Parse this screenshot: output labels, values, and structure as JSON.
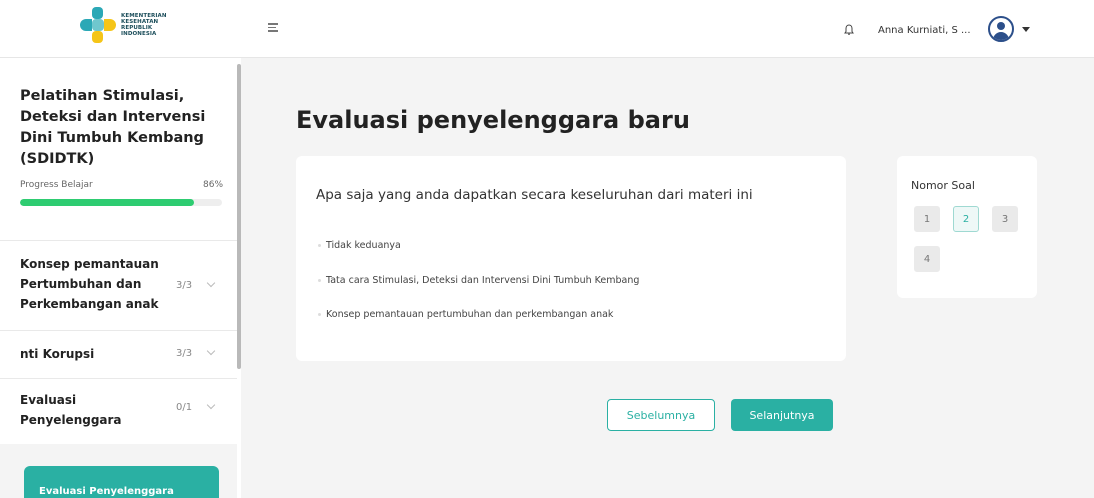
{
  "header": {
    "logo_text": [
      "KEMENTERIAN",
      "KESEHATAN",
      "REPUBLIK",
      "INDONESIA"
    ],
    "username": "Anna Kurniati, S ...",
    "icons": {
      "menu": "menu-icon",
      "bell": "bell-icon",
      "avatar": "user-avatar-icon",
      "caret": "caret-down-icon"
    }
  },
  "sidebar": {
    "course_title": "Pelatihan Stimulasi, Deteksi dan Intervensi Dini Tumbuh Kembang (SDIDTK)",
    "progress_label": "Progress Belajar",
    "progress_text": "86%",
    "progress_value": 0.86,
    "modules": [
      {
        "title": "Konsep pemantauan Pertumbuhan dan Perkembangan anak",
        "count": "3/3"
      },
      {
        "title": "nti Korupsi",
        "count": "3/3"
      },
      {
        "title": "Evaluasi Penyelenggara",
        "count": "0/1"
      }
    ],
    "active_subitem": "Evaluasi Penyelenggara"
  },
  "main": {
    "page_title": "Evaluasi penyelenggara baru",
    "question": "Apa saja yang anda dapatkan secara keseluruhan dari materi ini",
    "options": [
      "Tidak keduanya",
      "Tata cara Stimulasi, Deteksi dan Intervensi Dini Tumbuh Kembang",
      "Konsep pemantauan pertumbuhan dan perkembangan anak"
    ],
    "nav_title": "Nomor Soal",
    "question_numbers": [
      "1",
      "2",
      "3",
      "4"
    ],
    "active_question": "2",
    "prev_label": "Sebelumnya",
    "next_label": "Selanjutnya"
  },
  "colors": {
    "accent": "#2ab0a3",
    "progress": "#2ecc71",
    "background": "#f4f4f4"
  }
}
